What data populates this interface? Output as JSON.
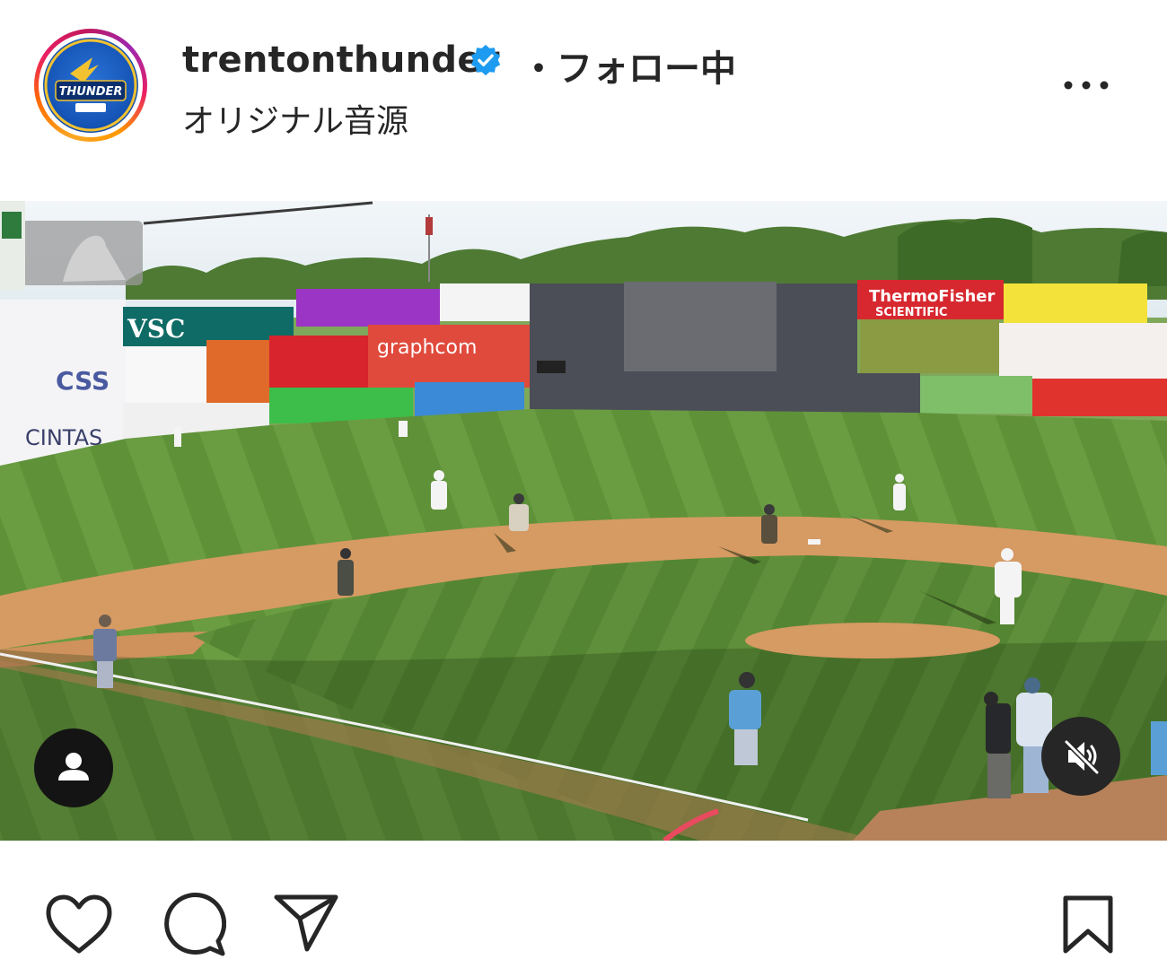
{
  "post": {
    "username": "trentonthunder",
    "separator": "・",
    "follow_status": "フォロー中",
    "audio_label": "オリジナル音源",
    "avatar_text": "THUNDER"
  },
  "icons": {
    "verified": "verified-badge-icon",
    "more": "more-options-icon",
    "person": "tagged-people-icon",
    "mute": "muted-speaker-icon",
    "like": "heart-icon",
    "comment": "comment-icon",
    "share": "share-icon",
    "save": "bookmark-icon"
  },
  "video": {
    "billboards": {
      "vsc": "VSC",
      "thermo_line1": "ThermoFisher",
      "thermo_line2": "SCIENTIFIC",
      "graphcom": "graphcom",
      "css": "CSS",
      "cintas": "CINTAS"
    }
  },
  "colors": {
    "verified": "#1d9bf0",
    "text": "#262626",
    "grass": "#6f9a45",
    "dirt": "#d9a06b"
  }
}
